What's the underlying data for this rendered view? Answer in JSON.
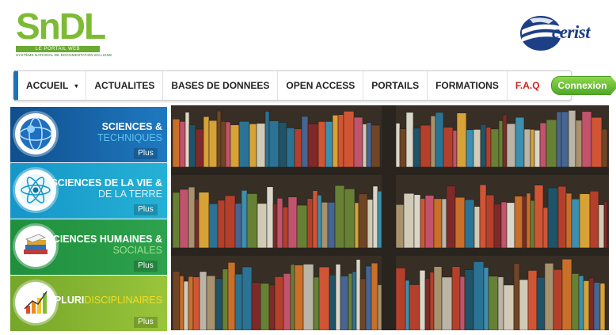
{
  "header": {
    "logo_text": "SnDL",
    "logo_sub1": "LE PORTAIL WEB",
    "logo_sub2": "SYSTÈME NATIONAL DE DOCUMENTATION EN LIGNE",
    "partner_logo_text": "cerist"
  },
  "nav": {
    "items": [
      {
        "label": "ACCUEIL"
      },
      {
        "label": "ACTUALITES"
      },
      {
        "label": "BASES DE DONNEES"
      },
      {
        "label": "OPEN ACCESS"
      },
      {
        "label": "PORTAILS"
      },
      {
        "label": "FORMATIONS"
      },
      {
        "label": "F.A.Q"
      }
    ],
    "accueil_caret": "▾",
    "connexion_label": "Connexion"
  },
  "categories": [
    {
      "line1": "SCIENCES &",
      "line2": "TECHNIQUES",
      "more": "Plus",
      "icon": "globe-network-icon"
    },
    {
      "line1": "SCIENCES DE LA VIE &",
      "line2": "DE LA TERRE",
      "more": "Plus",
      "icon": "atom-icon"
    },
    {
      "line1": "SCIENCES HUMAINES &",
      "line2": "SOCIALES",
      "more": "Plus",
      "icon": "books-icon"
    },
    {
      "line1a": "PLURI",
      "line1b": "DISCIPLINAIRES",
      "more": "Plus",
      "icon": "bar-chart-icon"
    }
  ],
  "colors": {
    "nav_accent": "#1e73b8",
    "faq": "#d42020",
    "connexion": "#5cb82e",
    "tile1": "#1565a8",
    "tile2": "#1aa3cd",
    "tile3": "#27994a",
    "tile4": "#8ab834"
  },
  "hero": {
    "icon": "bookshelf-photo"
  }
}
